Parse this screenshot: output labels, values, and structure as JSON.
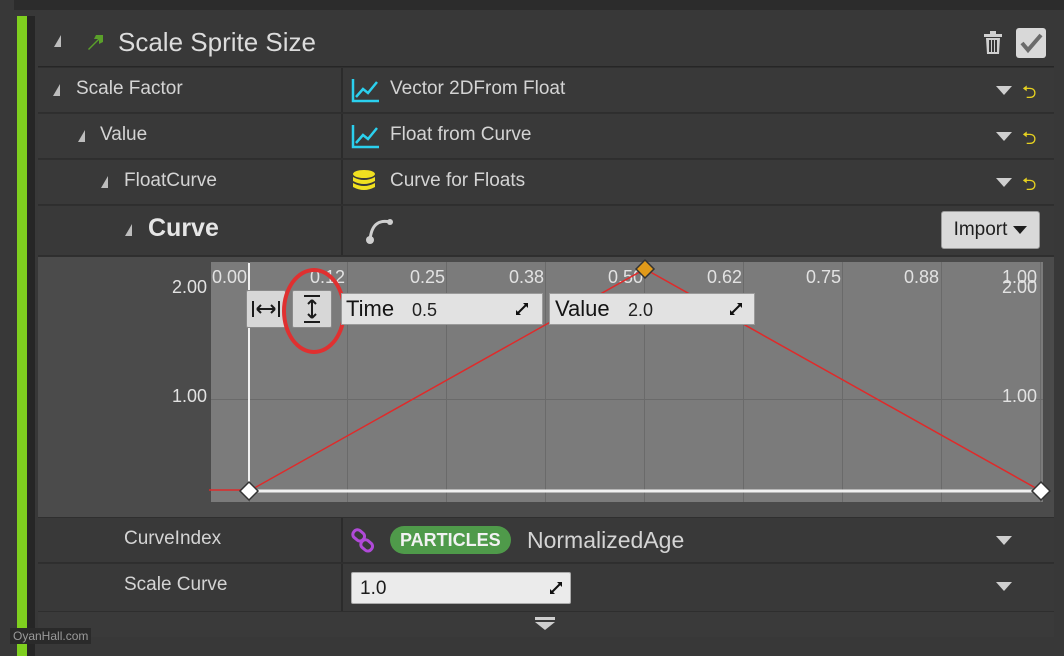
{
  "module": {
    "title": "Scale Sprite Size",
    "enabled": true
  },
  "rows": {
    "scale_factor": {
      "label": "Scale Factor",
      "value": "Vector 2DFrom Float"
    },
    "value": {
      "label": "Value",
      "value": "Float from Curve"
    },
    "float_curve": {
      "label": "FloatCurve",
      "value": "Curve for Floats"
    },
    "curve": {
      "label": "Curve",
      "import_label": "Import"
    }
  },
  "curve_editor": {
    "x_ticks": [
      "0.00",
      "0.12",
      "0.25",
      "0.38",
      "0.50",
      "0.62",
      "0.75",
      "0.88",
      "1.00"
    ],
    "y_ticks_left": [
      "2.00",
      "1.00"
    ],
    "y_ticks_right": [
      "2.00",
      "1.00"
    ],
    "time_label": "Time",
    "time_value": "0.5",
    "value_label": "Value",
    "value_value": "2.0",
    "fit_horizontal_icon": "fit-horizontal-icon",
    "fit_vertical_icon": "fit-vertical-icon",
    "curve_color": "#e02a2a",
    "selected_key_color": "#e09a1a",
    "keys": [
      {
        "time": 0.0,
        "value": 0.0
      },
      {
        "time": 0.5,
        "value": 2.0
      },
      {
        "time": 1.0,
        "value": 0.0
      }
    ]
  },
  "curve_index": {
    "label": "CurveIndex",
    "badge": "PARTICLES",
    "value": "NormalizedAge"
  },
  "scale_curve": {
    "label": "Scale Curve",
    "value": "1.0"
  },
  "watermark": "OyanHall.com",
  "colors": {
    "accent": "#7fcf1f",
    "particles_badge": "#4f9a4a",
    "reset_arrow": "#e5d020",
    "icon_cyan": "#2bd0ee",
    "icon_yellow": "#f0e020",
    "link_purple": "#b04ad8"
  }
}
